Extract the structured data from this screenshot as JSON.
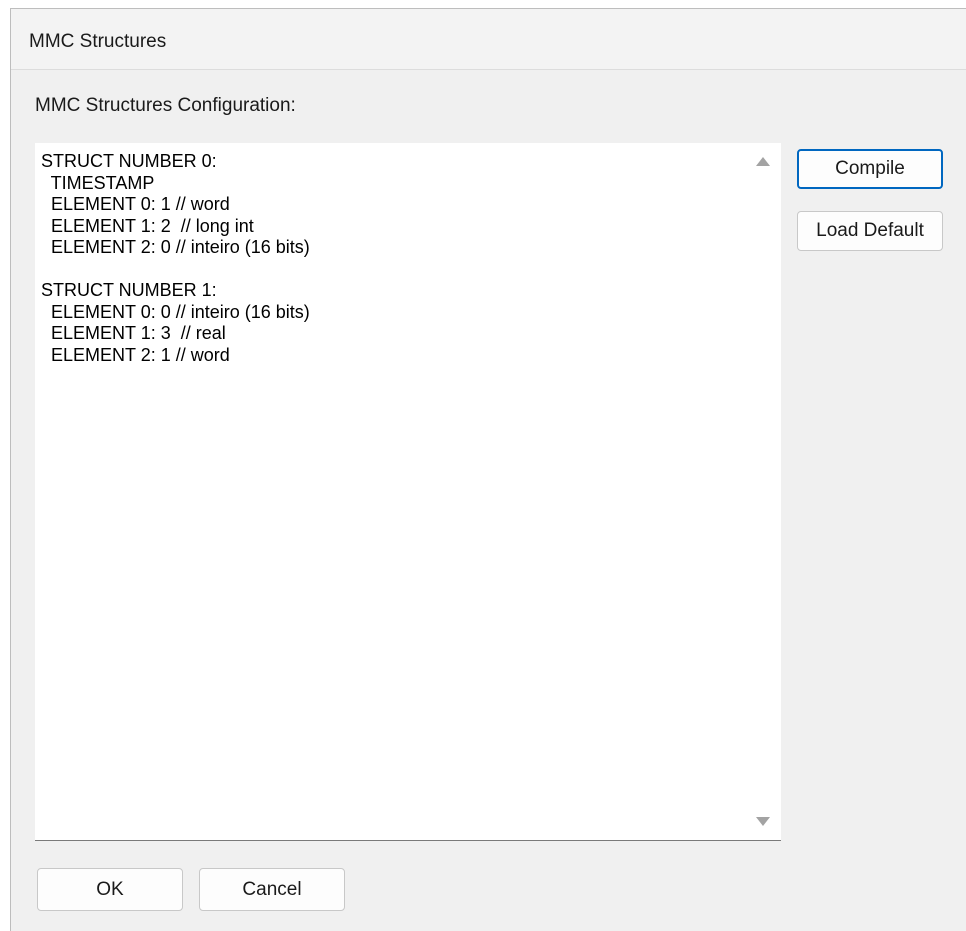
{
  "window": {
    "title": "MMC Structures"
  },
  "config": {
    "label": "MMC Structures Configuration:",
    "text": "STRUCT NUMBER 0:\n  TIMESTAMP\n  ELEMENT 0: 1 // word\n  ELEMENT 1: 2  // long int\n  ELEMENT 2: 0 // inteiro (16 bits)\n\nSTRUCT NUMBER 1:\n  ELEMENT 0: 0 // inteiro (16 bits)\n  ELEMENT 1: 3  // real\n  ELEMENT 2: 1 // word"
  },
  "buttons": {
    "compile": "Compile",
    "load_default": "Load Default",
    "ok": "OK",
    "cancel": "Cancel"
  },
  "icons": {
    "scroll_up": "arrow-up-icon",
    "scroll_down": "arrow-down-icon"
  },
  "colors": {
    "accent": "#0067c0",
    "dialog_bg": "#f0f0f0"
  }
}
